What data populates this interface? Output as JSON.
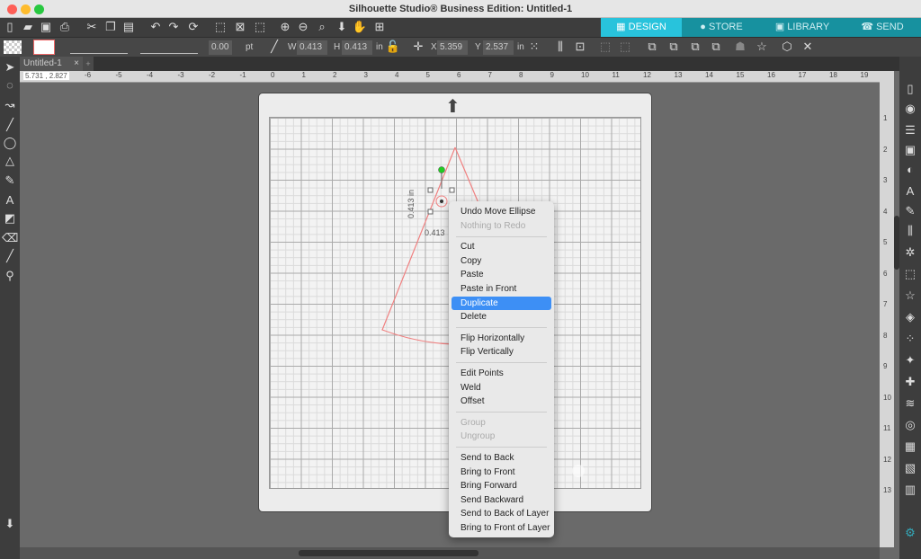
{
  "window": {
    "title": "Silhouette Studio® Business Edition: Untitled-1"
  },
  "nav_tabs": [
    {
      "label": "DESIGN",
      "icon": "grid-icon",
      "active": true
    },
    {
      "label": "STORE",
      "icon": "store-s-icon"
    },
    {
      "label": "LIBRARY",
      "icon": "folder-download-icon"
    },
    {
      "label": "SEND",
      "icon": "cutter-icon"
    }
  ],
  "props": {
    "stroke_width": "0.00",
    "stroke_unit": "pt",
    "w_label": "W",
    "w": "0.413",
    "h_label": "H",
    "h": "0.413",
    "size_unit": "in",
    "x_label": "X",
    "x": "5.359",
    "y_label": "Y",
    "y": "2.537",
    "pos_unit": "in"
  },
  "doc_tabs": [
    {
      "label": "Untitled-1",
      "close": "×"
    },
    {
      "label": "+"
    }
  ],
  "ruler": {
    "coords": "5.731 , 2.827",
    "ticks": [
      "-6",
      "-5",
      "-4",
      "-3",
      "-2",
      "-1",
      "0",
      "1",
      "2",
      "3",
      "4",
      "5",
      "6",
      "7",
      "8",
      "9",
      "10",
      "11",
      "12",
      "13",
      "14",
      "15",
      "16",
      "17",
      "18",
      "19"
    ],
    "vticks": [
      "1",
      "2",
      "3",
      "4",
      "5",
      "6",
      "7",
      "8",
      "9",
      "10",
      "11",
      "12",
      "13"
    ]
  },
  "selection": {
    "w_dim": "0.413",
    "h_dim": "0.413 in"
  },
  "colors": {
    "accent": "#28c3dc",
    "highlight": "#3d8ff5",
    "shape": "#f08080"
  },
  "context_menu": {
    "items": [
      {
        "label": "Undo Move Ellipse"
      },
      {
        "label": "Nothing to Redo",
        "disabled": true
      },
      {
        "sep": true
      },
      {
        "label": "Cut"
      },
      {
        "label": "Copy"
      },
      {
        "label": "Paste"
      },
      {
        "label": "Paste in Front"
      },
      {
        "label": "Duplicate",
        "highlighted": true
      },
      {
        "label": "Delete"
      },
      {
        "sep": true
      },
      {
        "label": "Flip Horizontally"
      },
      {
        "label": "Flip Vertically"
      },
      {
        "sep": true
      },
      {
        "label": "Edit Points"
      },
      {
        "label": "Weld"
      },
      {
        "label": "Offset"
      },
      {
        "sep": true
      },
      {
        "label": "Group",
        "disabled": true
      },
      {
        "label": "Ungroup",
        "disabled": true
      },
      {
        "sep": true
      },
      {
        "label": "Send to Back"
      },
      {
        "label": "Bring to Front"
      },
      {
        "label": "Bring Forward"
      },
      {
        "label": "Send Backward"
      },
      {
        "label": "Send to Back of Layer"
      },
      {
        "label": "Bring to Front of Layer"
      }
    ]
  }
}
